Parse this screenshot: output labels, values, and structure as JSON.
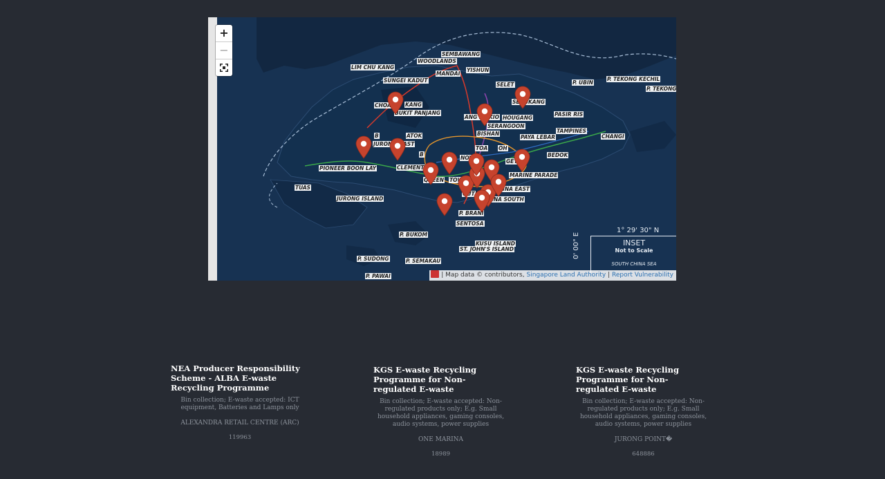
{
  "map": {
    "zoom_in_label": "+",
    "zoom_out_label": "−",
    "fullscreen_icon": "fullscreen-icon",
    "marker_icon": "map-pin-icon",
    "marker_color": "#c6432d",
    "marker_count": 16,
    "places": [
      {
        "id": "sembawang",
        "label": "SEMBAWANG"
      },
      {
        "id": "woodlands",
        "label": "WOODLANDS"
      },
      {
        "id": "mandai",
        "label": "MANDAI"
      },
      {
        "id": "yishun",
        "label": "YISHUN"
      },
      {
        "id": "lim-chu-kang",
        "label": "LIM CHU KANG"
      },
      {
        "id": "sungei-kadut",
        "label": "SUNGEI KADUT"
      },
      {
        "id": "seletar",
        "label": "SELET"
      },
      {
        "id": "p-ubin",
        "label": "P. UBIN"
      },
      {
        "id": "p-tekong-kechil",
        "label": "P. TEKONG KECHIL"
      },
      {
        "id": "p-tekong",
        "label": "P. TEKONG"
      },
      {
        "id": "choa-chu-kang",
        "label": "CHOA"
      },
      {
        "id": "choa-chu-kang-2",
        "label": "KANG"
      },
      {
        "id": "bukit-panjang",
        "label": "BUKIT PANJANG"
      },
      {
        "id": "sengkang",
        "label": "SENGKANG"
      },
      {
        "id": "ang-mo-kio",
        "label": "ANG M"
      },
      {
        "id": "ang-mo-kio-2",
        "label": "KIO"
      },
      {
        "id": "hougang",
        "label": "HOUGANG"
      },
      {
        "id": "serangoon",
        "label": "SERANGOON"
      },
      {
        "id": "pasir-ris",
        "label": "PASIR RIS"
      },
      {
        "id": "bishan",
        "label": "BISHAN"
      },
      {
        "id": "tampines",
        "label": "TAMPINES"
      },
      {
        "id": "bukit-batok",
        "label": "B"
      },
      {
        "id": "bukit-batok-2",
        "label": "ATOK"
      },
      {
        "id": "jurong-east",
        "label": "JURON"
      },
      {
        "id": "jurong-east-2",
        "label": "AST"
      },
      {
        "id": "paya-lebar",
        "label": "PAYA LEBAR"
      },
      {
        "id": "changi",
        "label": "CHANGI"
      },
      {
        "id": "toa-payoh",
        "label": "TOA"
      },
      {
        "id": "toa-payoh-2",
        "label": "OH"
      },
      {
        "id": "bedok",
        "label": "BEDOK"
      },
      {
        "id": "novena",
        "label": "NOV"
      },
      {
        "id": "geylang",
        "label": "GEYL"
      },
      {
        "id": "pioneer",
        "label": "PIONEER BOON LAY"
      },
      {
        "id": "clementi",
        "label": "CLEMENTI"
      },
      {
        "id": "b-timah",
        "label": "B"
      },
      {
        "id": "marine-parade",
        "label": "MARINE PARADE"
      },
      {
        "id": "queenstown",
        "label": "QUEEN"
      },
      {
        "id": "queenstown-2",
        "label": "TOWN"
      },
      {
        "id": "tuas",
        "label": "TUAS"
      },
      {
        "id": "marina-east",
        "label": "MARINA EAST"
      },
      {
        "id": "outram",
        "label": "OUT"
      },
      {
        "id": "jurong-island",
        "label": "JURONG ISLAND"
      },
      {
        "id": "marina-south",
        "label": "MARINA SOUTH"
      },
      {
        "id": "p-brani",
        "label": "P. BRANI"
      },
      {
        "id": "sentosa",
        "label": "SENTOSA"
      },
      {
        "id": "p-bukom",
        "label": "P. BUKOM"
      },
      {
        "id": "kusu-island",
        "label": "KUSU ISLAND"
      },
      {
        "id": "st-johns",
        "label": "ST. JOHN'S ISLAND"
      },
      {
        "id": "p-sudong",
        "label": "P. SUDONG"
      },
      {
        "id": "p-semakau",
        "label": "P. SEMAKAU"
      },
      {
        "id": "p-pawai",
        "label": "P. PAWAI"
      }
    ],
    "inset": {
      "coord_n": "1° 29' 30\" N",
      "coord_e": "0' 00\" E",
      "title": "INSET",
      "subtitle": "Not to Scale",
      "sea": "SOUTH CHINA SEA"
    },
    "attribution": {
      "prefix": "| Map data © contributors,",
      "link1": "Singapore Land Authority",
      "separator": "|",
      "link2": "Report Vulnerability"
    },
    "colors": {
      "sea": "#173252",
      "land": "#142a44",
      "shoreline": "#2c4c73",
      "mrt_green": "#3aa64a",
      "mrt_red": "#d93a2b",
      "mrt_purple": "#8e44ad",
      "mrt_orange": "#e6962c",
      "mrt_blue": "#2f6cc2"
    }
  },
  "cards": [
    {
      "title": "NEA Producer Responsibility Scheme - ALBA E-waste Recycling Programme",
      "description": "Bin collection; E-waste accepted: ICT equipment, Batteries and Lamps only",
      "location": "ALEXANDRA RETAIL CENTRE (ARC)",
      "postal": "119963"
    },
    {
      "title": "KGS E-waste Recycling Programme for Non-regulated E-waste",
      "description": "Bin collection; E-waste accepted: Non-regulated products only; E.g. Small household appliances, gaming consoles, audio systems, power supplies",
      "location": "ONE MARINA",
      "postal": "18989"
    },
    {
      "title": "KGS E-waste Recycling Programme for Non-regulated E-waste",
      "description": "Bin collection; E-waste accepted: Non-regulated products only; E.g. Small household appliances, gaming consoles, audio systems, power supplies",
      "location": "JURONG POINT�",
      "postal": "648886"
    }
  ]
}
